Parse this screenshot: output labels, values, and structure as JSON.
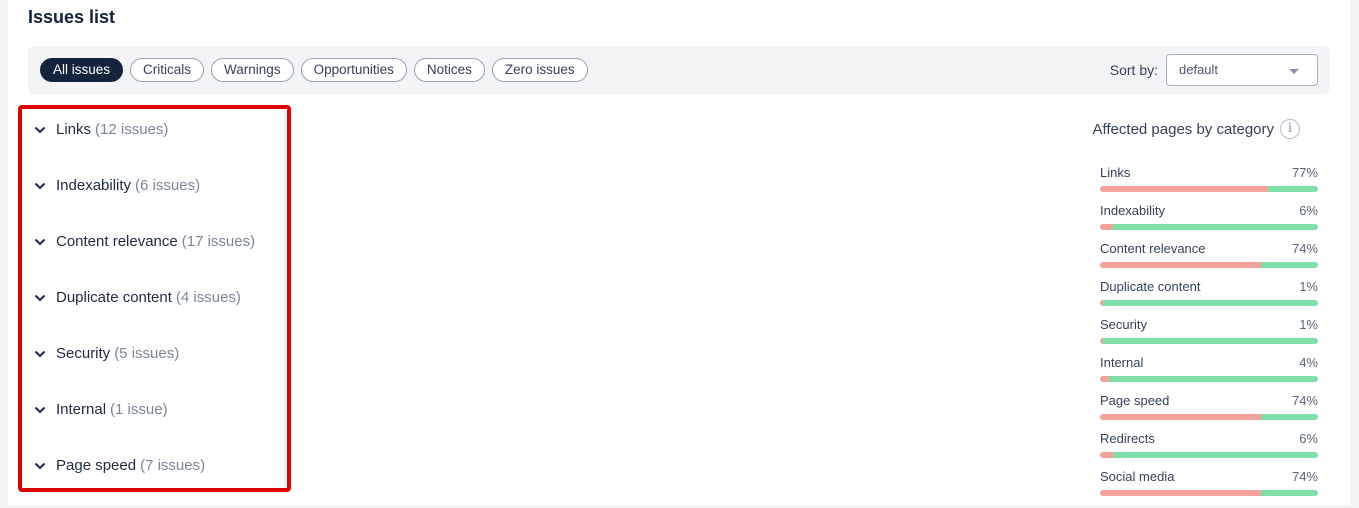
{
  "page": {
    "title": "Issues list"
  },
  "filters": {
    "chips": [
      {
        "label": "All issues",
        "active": true
      },
      {
        "label": "Criticals",
        "active": false
      },
      {
        "label": "Warnings",
        "active": false
      },
      {
        "label": "Opportunities",
        "active": false
      },
      {
        "label": "Notices",
        "active": false
      },
      {
        "label": "Zero issues",
        "active": false
      }
    ],
    "sort_label": "Sort by:",
    "sort_value": "default"
  },
  "issues": [
    {
      "name": "Links",
      "count": "(12 issues)"
    },
    {
      "name": "Indexability",
      "count": "(6 issues)"
    },
    {
      "name": "Content relevance",
      "count": "(17 issues)"
    },
    {
      "name": "Duplicate content",
      "count": "(4 issues)"
    },
    {
      "name": "Security",
      "count": "(5 issues)"
    },
    {
      "name": "Internal",
      "count": "(1 issue)"
    },
    {
      "name": "Page speed",
      "count": "(7 issues)"
    }
  ],
  "affected": {
    "title": "Affected pages by category",
    "colors": {
      "affected": "#f4a29a",
      "ok": "#7ee0a6"
    },
    "categories": [
      {
        "name": "Links",
        "percent_label": "77%",
        "percent": 77
      },
      {
        "name": "Indexability",
        "percent_label": "6%",
        "percent": 6
      },
      {
        "name": "Content relevance",
        "percent_label": "74%",
        "percent": 74
      },
      {
        "name": "Duplicate content",
        "percent_label": "1%",
        "percent": 1
      },
      {
        "name": "Security",
        "percent_label": "1%",
        "percent": 1
      },
      {
        "name": "Internal",
        "percent_label": "4%",
        "percent": 4
      },
      {
        "name": "Page speed",
        "percent_label": "74%",
        "percent": 74
      },
      {
        "name": "Redirects",
        "percent_label": "6%",
        "percent": 6
      },
      {
        "name": "Social media",
        "percent_label": "74%",
        "percent": 74
      }
    ]
  }
}
